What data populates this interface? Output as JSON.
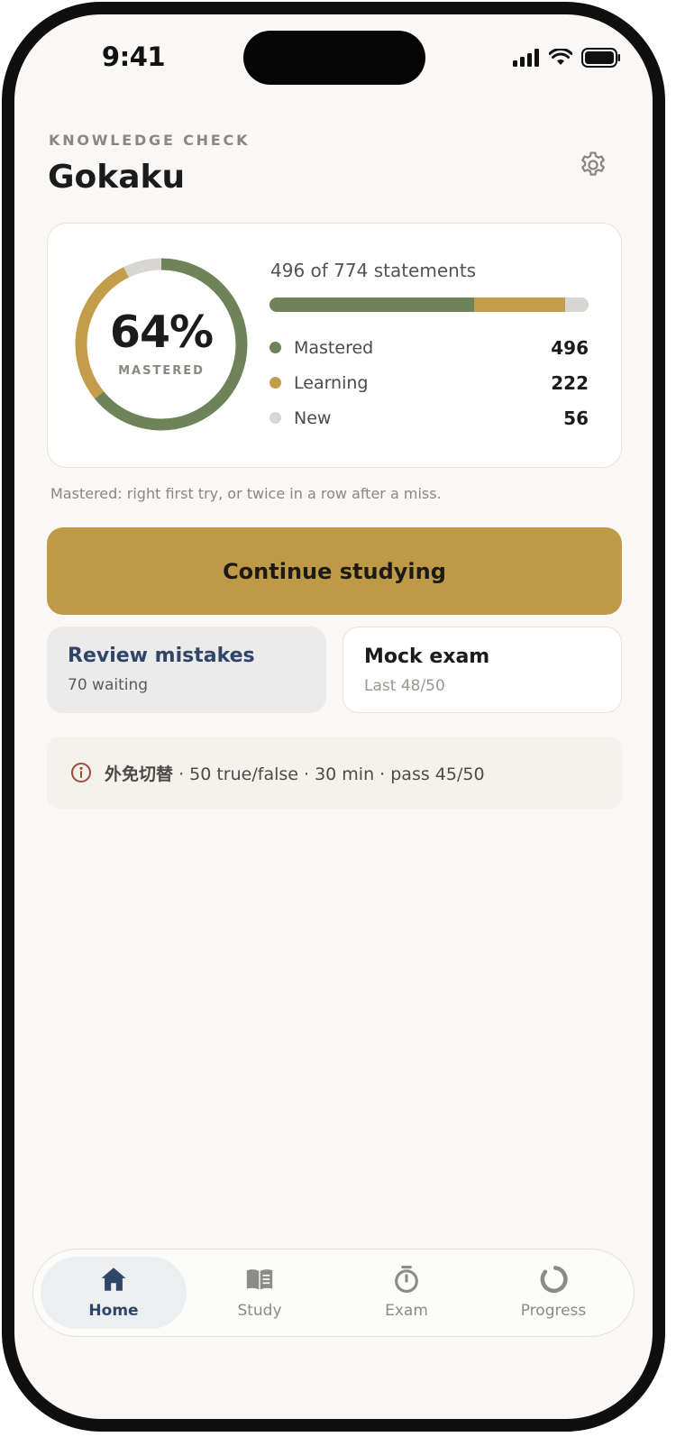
{
  "status_bar": {
    "time": "9:41"
  },
  "header": {
    "eyebrow": "KNOWLEDGE CHECK",
    "title": "Gokaku"
  },
  "stats": {
    "percent": "64%",
    "percent_label": "MASTERED",
    "summary": "496 of 774 statements",
    "total": 774,
    "legend": [
      {
        "label": "Mastered",
        "value": "496",
        "color": "#6e8358"
      },
      {
        "label": "Learning",
        "value": "222",
        "color": "#c39d49"
      },
      {
        "label": "New",
        "value": "56",
        "color": "#d8d6d2"
      }
    ]
  },
  "footnote": "Mastered: right first try, or twice in a row after a miss.",
  "cta": {
    "label": "Continue studying"
  },
  "tiles": {
    "review": {
      "title": "Review mistakes",
      "subtitle": "70 waiting"
    },
    "mock": {
      "title": "Mock exam",
      "subtitle": "Last 48/50"
    }
  },
  "info": {
    "exam_name": "外免切替",
    "details": "· 50 true/false · 30 min · pass 45/50"
  },
  "tabbar": {
    "tabs": [
      {
        "label": "Home",
        "icon": "home-icon",
        "active": true
      },
      {
        "label": "Study",
        "icon": "book-icon",
        "active": false
      },
      {
        "label": "Exam",
        "icon": "stopwatch-icon",
        "active": false
      },
      {
        "label": "Progress",
        "icon": "progress-ring-icon",
        "active": false
      }
    ]
  },
  "colors": {
    "accent": "#bf9a46",
    "mastered": "#6e8358",
    "learning": "#c39d49",
    "new": "#d8d6d2",
    "nav_active": "#2f4669"
  }
}
